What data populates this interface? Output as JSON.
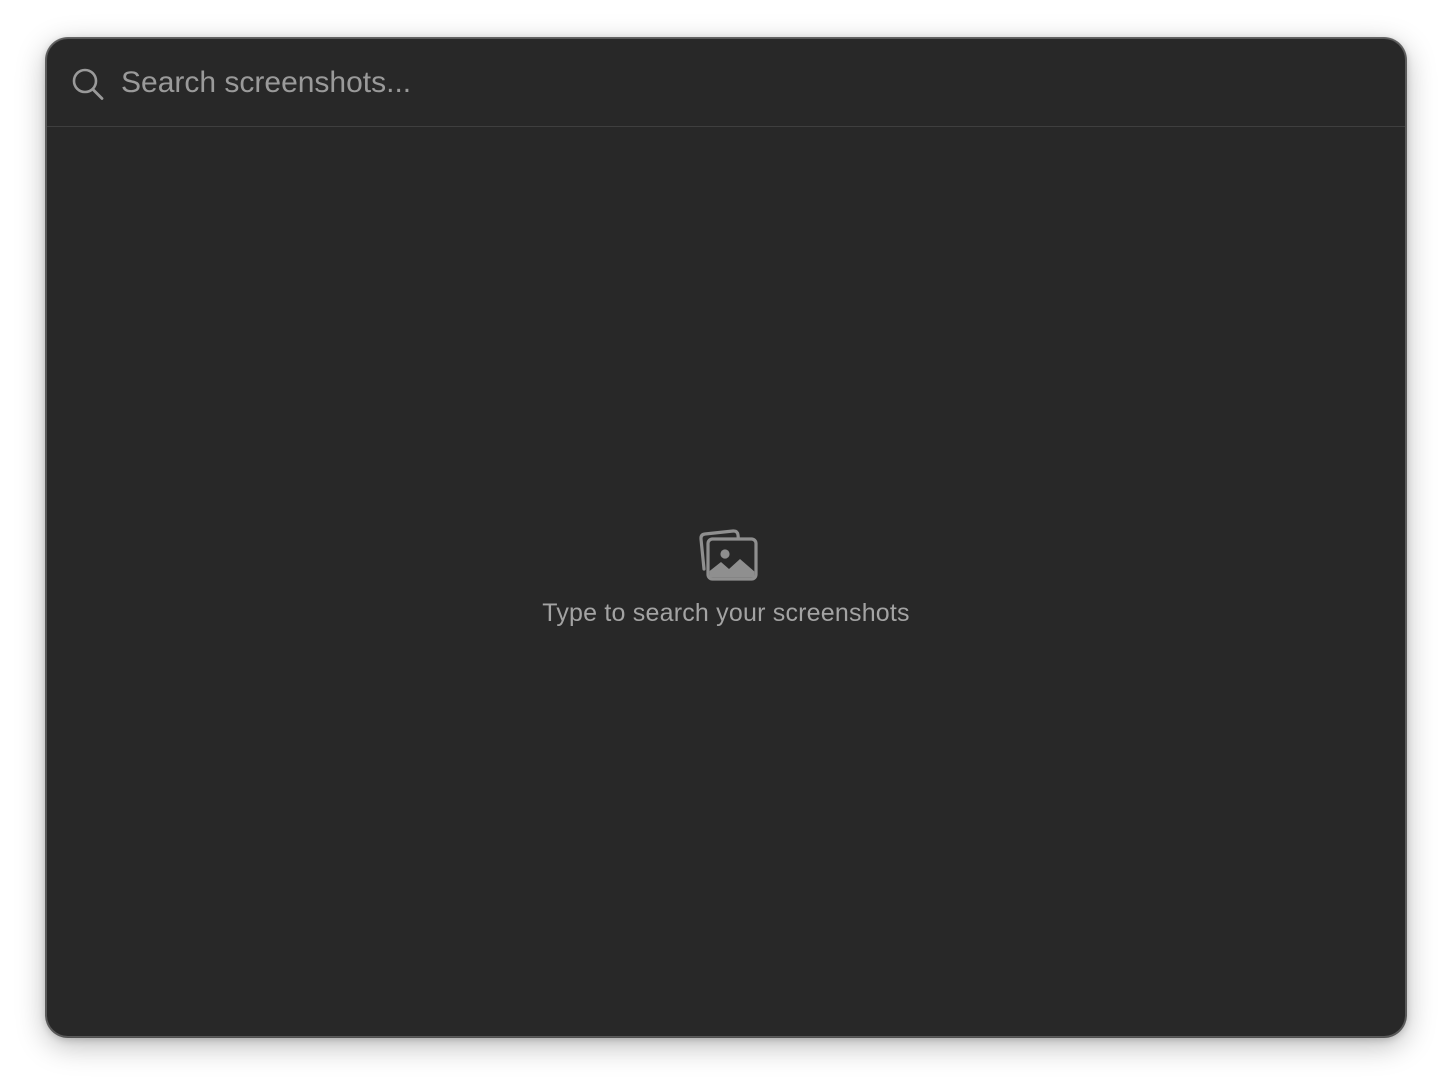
{
  "search": {
    "placeholder": "Search screenshots...",
    "value": "",
    "icon": "magnifying-glass-icon"
  },
  "empty_state": {
    "icon": "photos-stack-icon",
    "message": "Type to search your screenshots"
  },
  "colors": {
    "window_background": "#282828",
    "placeholder_text": "#9a9a9a",
    "message_text": "#a3a3a3",
    "icon": "#8f8f8f",
    "divider": "#3f3f3f"
  }
}
